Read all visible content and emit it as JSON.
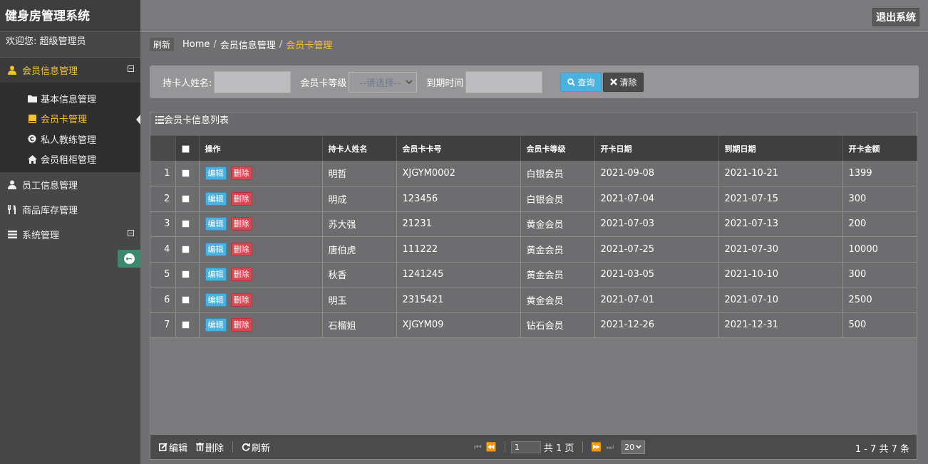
{
  "app": {
    "title": "健身房管理系统",
    "welcome": "欢迎您:  超级管理员",
    "logout": "退出系统"
  },
  "sidebar": {
    "groups": [
      {
        "label": "会员信息管理",
        "icon": "user-icon",
        "expanded": true,
        "items": [
          {
            "label": "基本信息管理",
            "icon": "folder-icon"
          },
          {
            "label": "会员卡管理",
            "icon": "book-icon",
            "active": true
          },
          {
            "label": "私人教练管理",
            "icon": "copyright-icon"
          },
          {
            "label": "会员租柜管理",
            "icon": "home-icon"
          }
        ]
      },
      {
        "label": "员工信息管理",
        "icon": "user-icon"
      },
      {
        "label": "商品库存管理",
        "icon": "cutlery-icon"
      },
      {
        "label": "系统管理",
        "icon": "list-icon",
        "expanded": true
      }
    ]
  },
  "breadcrumb": {
    "refresh": "刷新",
    "items": [
      "Home",
      "会员信息管理",
      "会员卡管理"
    ]
  },
  "search": {
    "name_label": "持卡人姓名:",
    "level_label": "会员卡等级",
    "level_value": "--请选择--",
    "expire_label": "到期时间",
    "query_button": "查询",
    "clear_button": "清除"
  },
  "grid": {
    "title": "会员卡信息列表",
    "columns": [
      "操作",
      "持卡人姓名",
      "会员卡卡号",
      "会员卡等级",
      "开卡日期",
      "到期日期",
      "开卡金额"
    ],
    "edit_label": "编辑",
    "delete_label": "删除",
    "rows": [
      {
        "no": "1",
        "name": "明哲",
        "card": "XJGYM0002",
        "level": "白银会员",
        "open": "2021-09-08",
        "expire": "2021-10-21",
        "amount": "1399"
      },
      {
        "no": "2",
        "name": "明成",
        "card": "123456",
        "level": "白银会员",
        "open": "2021-07-04",
        "expire": "2021-07-15",
        "amount": "300"
      },
      {
        "no": "3",
        "name": "苏大强",
        "card": "21231",
        "level": "黄金会员",
        "open": "2021-07-03",
        "expire": "2021-07-13",
        "amount": "200"
      },
      {
        "no": "4",
        "name": "唐伯虎",
        "card": "111222",
        "level": "黄金会员",
        "open": "2021-07-25",
        "expire": "2021-07-30",
        "amount": "10000"
      },
      {
        "no": "5",
        "name": "秋香",
        "card": "1241245",
        "level": "黄金会员",
        "open": "2021-03-05",
        "expire": "2021-10-10",
        "amount": "300"
      },
      {
        "no": "6",
        "name": "明玉",
        "card": "2315421",
        "level": "黄金会员",
        "open": "2021-07-01",
        "expire": "2021-07-10",
        "amount": "2500"
      },
      {
        "no": "7",
        "name": "石榴姐",
        "card": "XJGYM09",
        "level": "钻石会员",
        "open": "2021-12-26",
        "expire": "2021-12-31",
        "amount": "500"
      }
    ]
  },
  "pager": {
    "edit": "编辑",
    "delete": "删除",
    "refresh": "刷新",
    "page_value": "1",
    "total_pages": "共 1 页",
    "page_size": "20",
    "info": "1 - 7   共 7 条"
  }
}
